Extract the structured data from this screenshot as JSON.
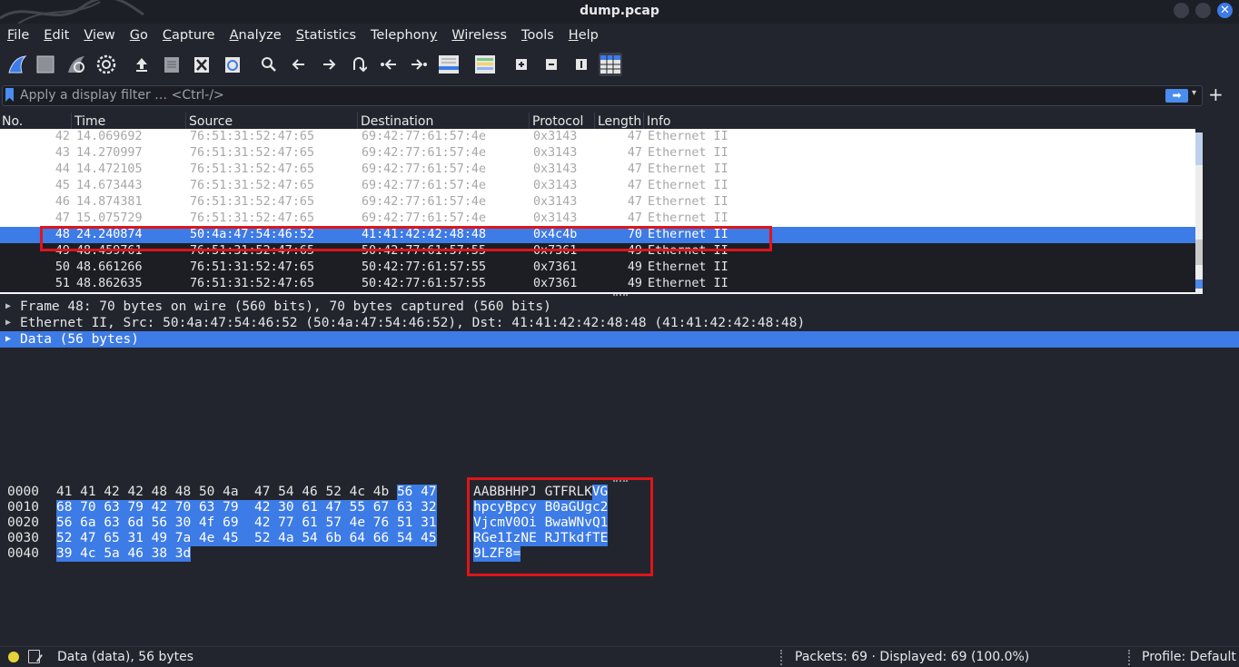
{
  "window": {
    "title": "dump.pcap"
  },
  "menu": [
    {
      "ul": "F",
      "rest": "ile"
    },
    {
      "ul": "E",
      "rest": "dit"
    },
    {
      "ul": "V",
      "rest": "iew"
    },
    {
      "ul": "G",
      "rest": "o"
    },
    {
      "ul": "C",
      "rest": "apture"
    },
    {
      "ul": "A",
      "rest": "nalyze"
    },
    {
      "ul": "S",
      "rest": "tatistics"
    },
    {
      "ul": "",
      "rest": "Telephon",
      "ul2": "y"
    },
    {
      "ul": "W",
      "rest": "ireless"
    },
    {
      "ul": "T",
      "rest": "ools"
    },
    {
      "ul": "H",
      "rest": "elp"
    }
  ],
  "toolbar_icons": [
    "shark-fin-icon",
    "stop-icon",
    "restart-icon",
    "options-gear-icon",
    "open-file-icon",
    "file-set-icon",
    "close-file-icon",
    "reload-icon",
    "find-icon",
    "back-icon",
    "forward-icon",
    "jump-icon",
    "first-icon",
    "last-icon",
    "autoscroll-icon",
    "colorize-icon",
    "zoom-in-icon",
    "zoom-out-icon",
    "normal-size-icon",
    "resize-columns-icon"
  ],
  "filter": {
    "placeholder": "Apply a display filter … <Ctrl-/>",
    "apply": "➡",
    "dropdown": "▾",
    "add": "+"
  },
  "packet_list": {
    "columns": [
      "No.",
      "Time",
      "Source",
      "Destination",
      "Protocol",
      "Length",
      "Info"
    ],
    "rows": [
      {
        "no": "42",
        "time": "14.069692",
        "src": "76:51:31:52:47:65",
        "dst": "69:42:77:61:57:4e",
        "proto": "0x3143",
        "len": "47",
        "info": "Ethernet II",
        "style": "dim"
      },
      {
        "no": "43",
        "time": "14.270997",
        "src": "76:51:31:52:47:65",
        "dst": "69:42:77:61:57:4e",
        "proto": "0x3143",
        "len": "47",
        "info": "Ethernet II",
        "style": "dim"
      },
      {
        "no": "44",
        "time": "14.472105",
        "src": "76:51:31:52:47:65",
        "dst": "69:42:77:61:57:4e",
        "proto": "0x3143",
        "len": "47",
        "info": "Ethernet II",
        "style": "dim"
      },
      {
        "no": "45",
        "time": "14.673443",
        "src": "76:51:31:52:47:65",
        "dst": "69:42:77:61:57:4e",
        "proto": "0x3143",
        "len": "47",
        "info": "Ethernet II",
        "style": "dim"
      },
      {
        "no": "46",
        "time": "14.874381",
        "src": "76:51:31:52:47:65",
        "dst": "69:42:77:61:57:4e",
        "proto": "0x3143",
        "len": "47",
        "info": "Ethernet II",
        "style": "dim"
      },
      {
        "no": "47",
        "time": "15.075729",
        "src": "76:51:31:52:47:65",
        "dst": "69:42:77:61:57:4e",
        "proto": "0x3143",
        "len": "47",
        "info": "Ethernet II",
        "style": "dim"
      },
      {
        "no": "48",
        "time": "24.240874",
        "src": "50:4a:47:54:46:52",
        "dst": "41:41:42:42:48:48",
        "proto": "0x4c4b",
        "len": "70",
        "info": "Ethernet II",
        "style": "sel"
      },
      {
        "no": "49",
        "time": "48.459761",
        "src": "76:51:31:52:47:65",
        "dst": "50:42:77:61:57:55",
        "proto": "0x7361",
        "len": "49",
        "info": "Ethernet II",
        "style": "dark"
      },
      {
        "no": "50",
        "time": "48.661266",
        "src": "76:51:31:52:47:65",
        "dst": "50:42:77:61:57:55",
        "proto": "0x7361",
        "len": "49",
        "info": "Ethernet II",
        "style": "dark"
      },
      {
        "no": "51",
        "time": "48.862635",
        "src": "76:51:31:52:47:65",
        "dst": "50:42:77:61:57:55",
        "proto": "0x7361",
        "len": "49",
        "info": "Ethernet II",
        "style": "dark"
      }
    ]
  },
  "details": [
    {
      "text": "Frame 48: 70 bytes on wire (560 bits), 70 bytes captured (560 bits)",
      "selected": false
    },
    {
      "text": "Ethernet II, Src: 50:4a:47:54:46:52 (50:4a:47:54:46:52), Dst: 41:41:42:42:48:48 (41:41:42:42:48:48)",
      "selected": false
    },
    {
      "text": "Data (56 bytes)",
      "selected": true
    }
  ],
  "bytes": {
    "rows": [
      {
        "offset": "0000",
        "hex": [
          "41",
          "41",
          "42",
          "42",
          "48",
          "48",
          "50",
          "4a",
          "47",
          "54",
          "46",
          "52",
          "4c",
          "4b",
          "56",
          "47"
        ],
        "hl_from": 14,
        "ascii": "AABBHHPJ GTFRLKVG",
        "ascii_hl_from": 15
      },
      {
        "offset": "0010",
        "hex": [
          "68",
          "70",
          "63",
          "79",
          "42",
          "70",
          "63",
          "79",
          "42",
          "30",
          "61",
          "47",
          "55",
          "67",
          "63",
          "32"
        ],
        "hl_from": 0,
        "ascii": "hpcyBpcy B0aGUgc2",
        "ascii_hl_from": 0
      },
      {
        "offset": "0020",
        "hex": [
          "56",
          "6a",
          "63",
          "6d",
          "56",
          "30",
          "4f",
          "69",
          "42",
          "77",
          "61",
          "57",
          "4e",
          "76",
          "51",
          "31"
        ],
        "hl_from": 0,
        "ascii": "VjcmV0Oi BwaWNvQ1",
        "ascii_hl_from": 0
      },
      {
        "offset": "0030",
        "hex": [
          "52",
          "47",
          "65",
          "31",
          "49",
          "7a",
          "4e",
          "45",
          "52",
          "4a",
          "54",
          "6b",
          "64",
          "66",
          "54",
          "45"
        ],
        "hl_from": 0,
        "ascii": "RGe1IzNE RJTkdfTE",
        "ascii_hl_from": 0
      },
      {
        "offset": "0040",
        "hex": [
          "39",
          "4c",
          "5a",
          "46",
          "38",
          "3d"
        ],
        "hl_from": 0,
        "ascii": "9LZF8=",
        "ascii_hl_from": 0
      }
    ]
  },
  "status": {
    "left": "Data (data), 56 bytes",
    "packets": "Packets: 69 · Displayed: 69 (100.0%)",
    "profile": "Profile: Default"
  },
  "colors": {
    "accent": "#3d7be6",
    "annotation": "#e0141b",
    "background": "#22252e"
  }
}
